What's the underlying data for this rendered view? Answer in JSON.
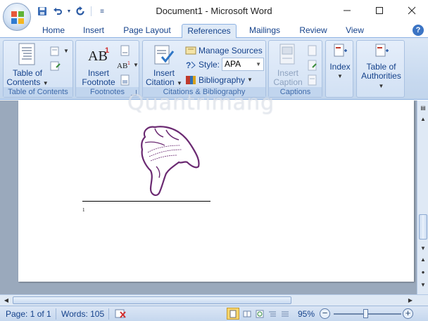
{
  "window": {
    "title": "Document1 - Microsoft Word"
  },
  "quick_access": {
    "save_icon": "save-icon",
    "undo_icon": "undo-icon",
    "redo_icon": "redo-icon",
    "customize_icon": "customize-qat-icon"
  },
  "tabs": [
    {
      "label": "Home"
    },
    {
      "label": "Insert"
    },
    {
      "label": "Page Layout"
    },
    {
      "label": "References"
    },
    {
      "label": "Mailings"
    },
    {
      "label": "Review"
    },
    {
      "label": "View"
    }
  ],
  "active_tab": "References",
  "ribbon": {
    "toc": {
      "button_line1": "Table of",
      "button_line2": "Contents",
      "group_label": "Table of Contents"
    },
    "footnotes": {
      "button_line1": "Insert",
      "button_line2": "Footnote",
      "group_label": "Footnotes"
    },
    "citations": {
      "button_line1": "Insert",
      "button_line2": "Citation",
      "manage_sources": "Manage Sources",
      "style_label": "Style:",
      "style_value": "APA",
      "bibliography": "Bibliography",
      "group_label": "Citations & Bibliography"
    },
    "captions": {
      "button_line1": "Insert",
      "button_line2": "Caption",
      "group_label": "Captions"
    },
    "index": {
      "button_label": "Index"
    },
    "authorities": {
      "button_line1": "Table of",
      "button_line2": "Authorities"
    }
  },
  "document": {
    "watermark": "Quantrimang",
    "footnote_number": "1"
  },
  "status": {
    "page": "Page: 1 of 1",
    "words": "Words: 105",
    "zoom": "95%",
    "zoom_level_percent": 95
  },
  "colors": {
    "ribbon_accent": "#15428b",
    "hand_outline": "#6b2a72"
  }
}
